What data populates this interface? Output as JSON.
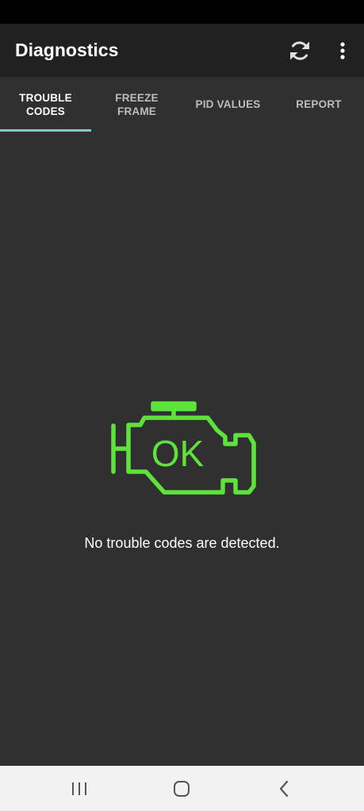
{
  "app_bar": {
    "title": "Diagnostics",
    "actions": [
      {
        "name": "refresh",
        "icon": "refresh-icon"
      },
      {
        "name": "more-options",
        "icon": "more-vert-icon"
      }
    ]
  },
  "tabs": [
    {
      "label": "TROUBLE\nCODES",
      "active": true
    },
    {
      "label": "FREEZE\nFRAME",
      "active": false
    },
    {
      "label": "PID VALUES",
      "active": false
    },
    {
      "label": "REPORT",
      "active": false
    }
  ],
  "main": {
    "status_icon": "check-engine-ok-icon",
    "icon_text": "OK",
    "message": "No trouble codes are detected."
  },
  "nav_bar": {
    "buttons": [
      {
        "name": "recent-apps",
        "icon": "recent-apps-icon"
      },
      {
        "name": "home",
        "icon": "home-icon"
      },
      {
        "name": "back",
        "icon": "back-icon"
      }
    ]
  },
  "colors": {
    "app_bar": "#212121",
    "background": "#303030",
    "tab_indicator": "#80cbc4",
    "engine_ok": "#5ee33c",
    "nav_bar": "#f2f2f2"
  }
}
